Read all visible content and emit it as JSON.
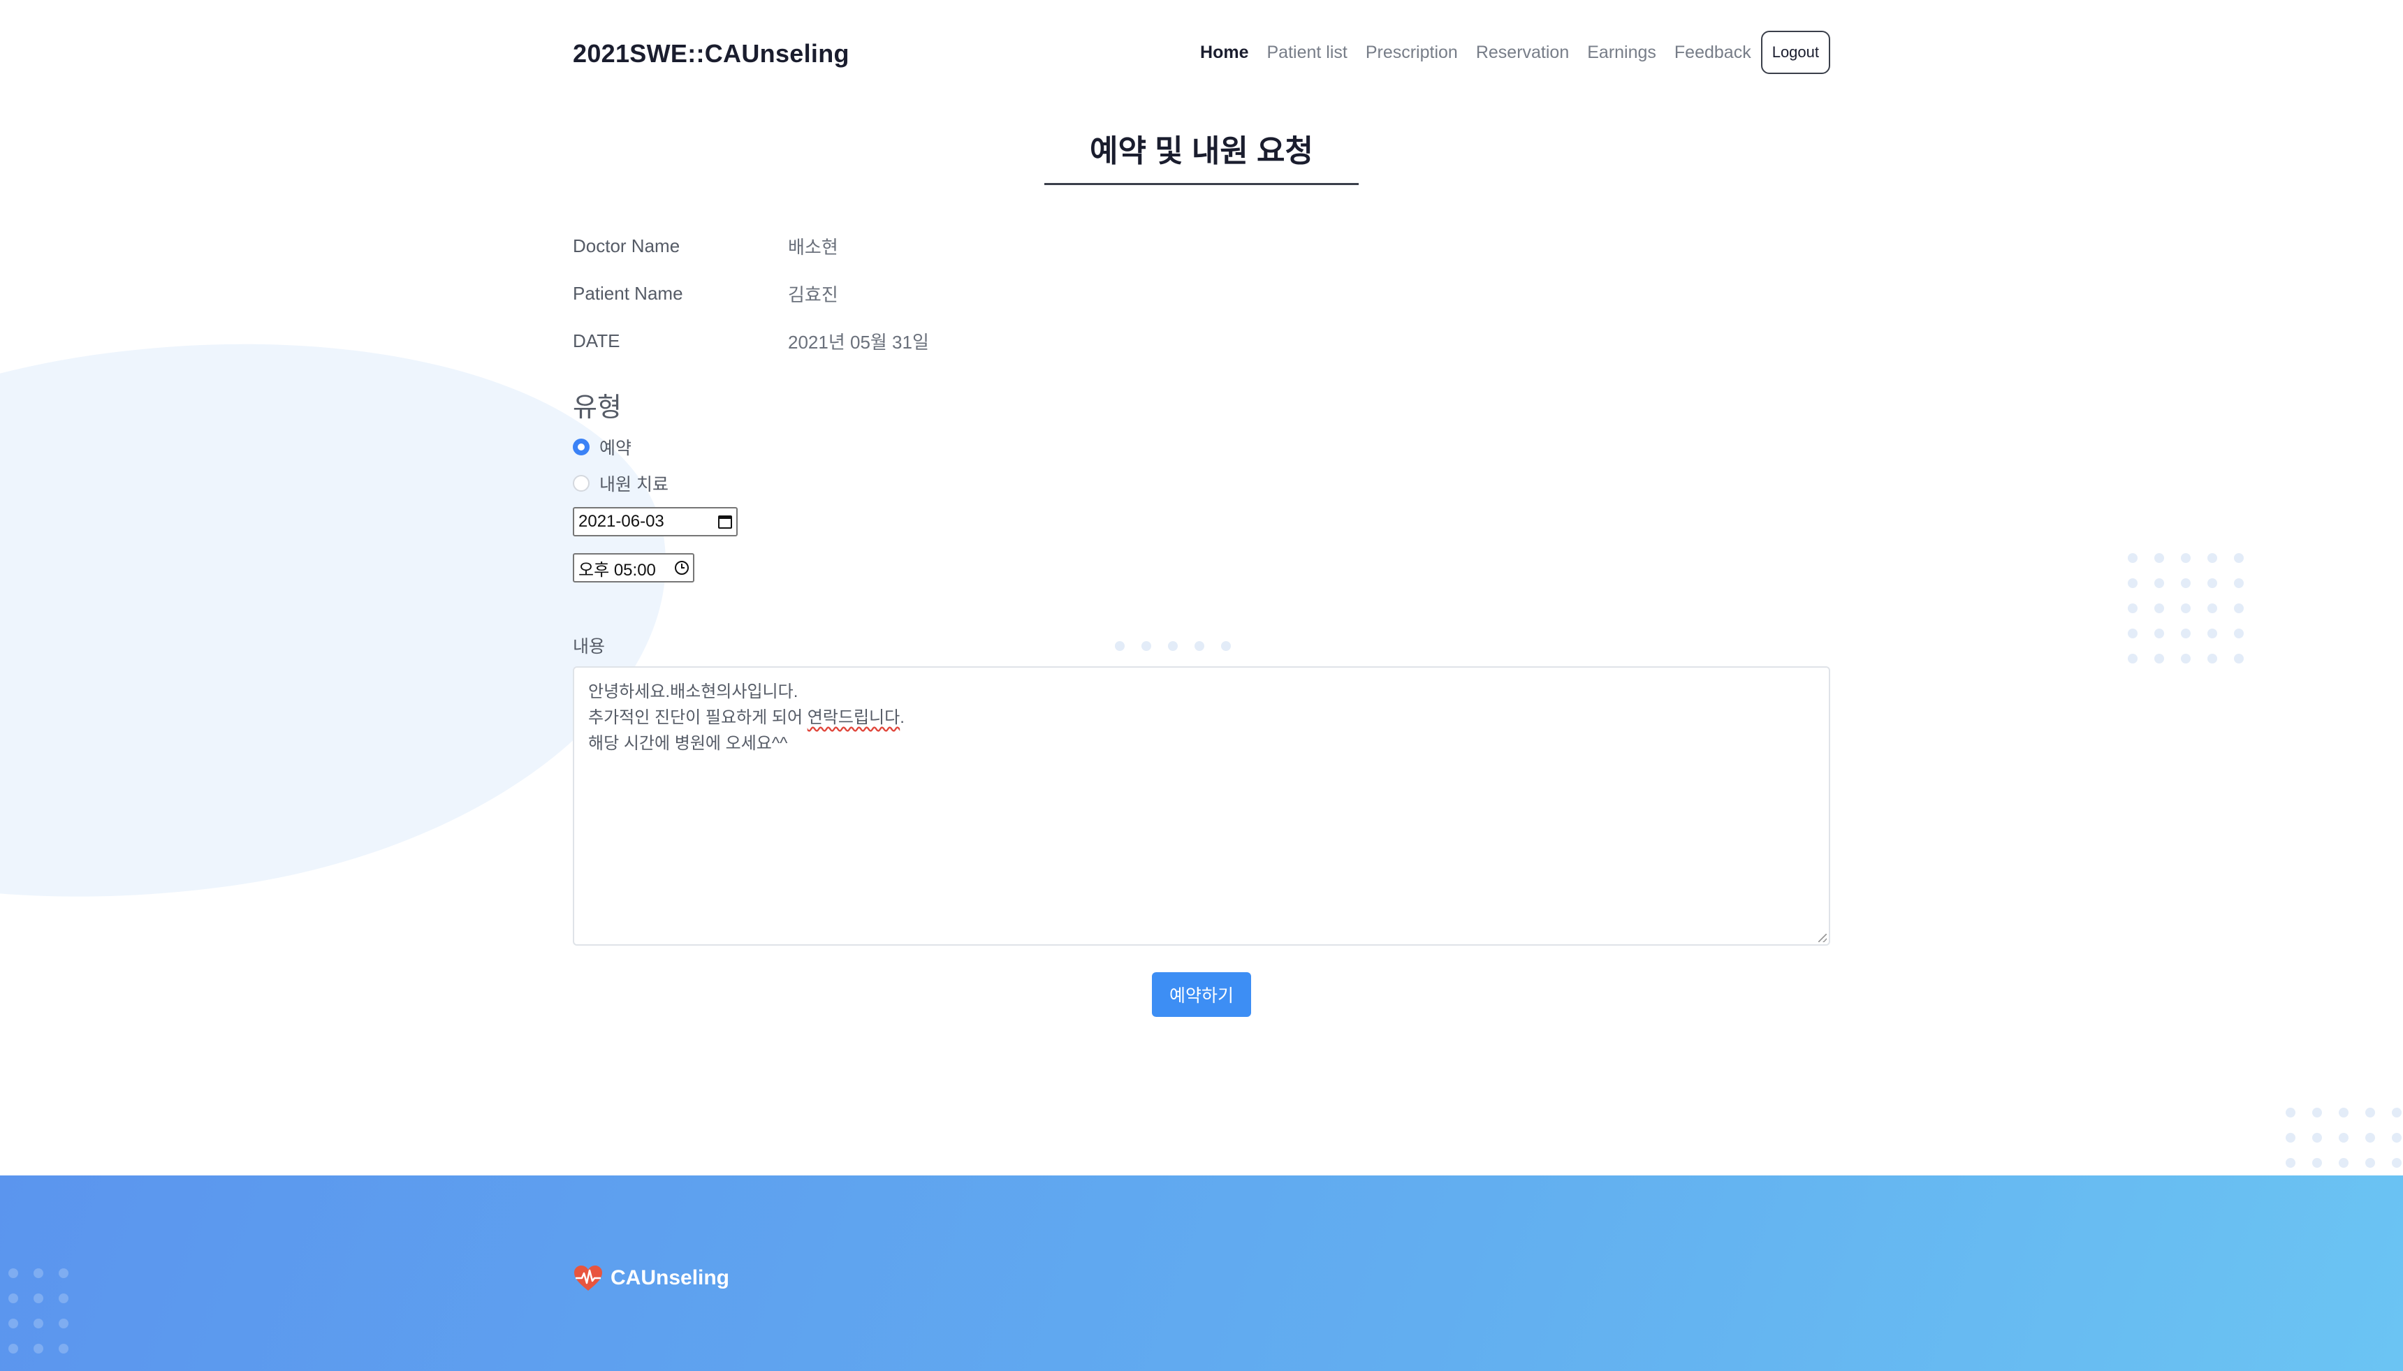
{
  "header": {
    "brand": "2021SWE::CAUnseling",
    "nav": [
      {
        "label": "Home",
        "active": true
      },
      {
        "label": "Patient list",
        "active": false
      },
      {
        "label": "Prescription",
        "active": false
      },
      {
        "label": "Reservation",
        "active": false
      },
      {
        "label": "Earnings",
        "active": false
      },
      {
        "label": "Feedback",
        "active": false
      }
    ],
    "logout_label": "Logout"
  },
  "page": {
    "title": "예약 및 내원 요청"
  },
  "info": {
    "rows": [
      {
        "label": "Doctor Name",
        "value": "배소현"
      },
      {
        "label": "Patient Name",
        "value": "김효진"
      },
      {
        "label": "DATE",
        "value": "2021년 05월 31일"
      }
    ]
  },
  "type": {
    "heading": "유형",
    "options": [
      {
        "label": "예약",
        "checked": true
      },
      {
        "label": "내원 치료",
        "checked": false
      }
    ],
    "date_value": "2021-06-03",
    "time_value": "오후 05:00"
  },
  "content": {
    "label": "내용",
    "line1": "안녕하세요.배소현의사입니다.",
    "line2_before": "추가적인 진단이 필요하게 되어 ",
    "line2_flagged": "연락드립니다",
    "line2_after": ".",
    "line3": "해당 시간에 병원에 오세요^^"
  },
  "submit_label": "예약하기",
  "footer": {
    "brand": "CAUnseling"
  },
  "colors": {
    "accent": "#3d8ef4",
    "footer_start": "#5b95ee",
    "footer_end": "#6bc4f3",
    "heart": "#e8553e",
    "text_dark": "#1a1d2e",
    "text_muted": "#555b66"
  },
  "icons": {
    "logo": "heart-pulse-icon",
    "date": "calendar-icon",
    "time": "clock-icon"
  }
}
